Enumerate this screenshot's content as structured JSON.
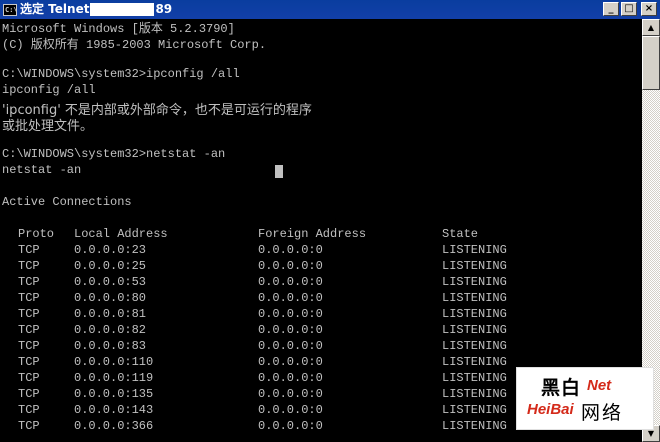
{
  "window": {
    "title_prefix": "选定 Telnet",
    "title_suffix": "89",
    "icon_text": "C:\\",
    "minimize": "_",
    "maximize": "□",
    "close": "×"
  },
  "console": {
    "lines": [
      "Microsoft Windows [版本 5.2.3790]",
      "(C) 版权所有 1985-2003 Microsoft Corp.",
      "",
      "C:\\WINDOWS\\system32>ipconfig /all",
      "ipconfig /all",
      "'ipconfig' 不是内部或外部命令，也不是可运行的程序",
      "或批处理文件。",
      "",
      "C:\\WINDOWS\\system32>netstat -an",
      "netstat -an",
      "",
      "Active Connections",
      ""
    ],
    "table": {
      "headers": [
        "Proto",
        "Local Address",
        "Foreign Address",
        "State"
      ],
      "rows": [
        [
          "TCP",
          "0.0.0.0:23",
          "0.0.0.0:0",
          "LISTENING"
        ],
        [
          "TCP",
          "0.0.0.0:25",
          "0.0.0.0:0",
          "LISTENING"
        ],
        [
          "TCP",
          "0.0.0.0:53",
          "0.0.0.0:0",
          "LISTENING"
        ],
        [
          "TCP",
          "0.0.0.0:80",
          "0.0.0.0:0",
          "LISTENING"
        ],
        [
          "TCP",
          "0.0.0.0:81",
          "0.0.0.0:0",
          "LISTENING"
        ],
        [
          "TCP",
          "0.0.0.0:82",
          "0.0.0.0:0",
          "LISTENING"
        ],
        [
          "TCP",
          "0.0.0.0:83",
          "0.0.0.0:0",
          "LISTENING"
        ],
        [
          "TCP",
          "0.0.0.0:110",
          "0.0.0.0:0",
          "LISTENING"
        ],
        [
          "TCP",
          "0.0.0.0:119",
          "0.0.0.0:0",
          "LISTENING"
        ],
        [
          "TCP",
          "0.0.0.0:135",
          "0.0.0.0:0",
          "LISTENING"
        ],
        [
          "TCP",
          "0.0.0.0:143",
          "0.0.0.0:0",
          "LISTENING"
        ],
        [
          "TCP",
          "0.0.0.0:366",
          "0.0.0.0:0",
          "LISTENING"
        ]
      ]
    }
  },
  "scrollbar": {
    "up": "▲",
    "down": "▼"
  },
  "watermark": {
    "cn_top": "黑白",
    "net": "Net",
    "heibai": "HeiBai",
    "cn_bottom": "网络"
  },
  "colors": {
    "console_bg": "#000000",
    "console_text": "#c0c0c0",
    "titlebar": "#0a3d9f",
    "watermark_red": "#d42a1a"
  }
}
